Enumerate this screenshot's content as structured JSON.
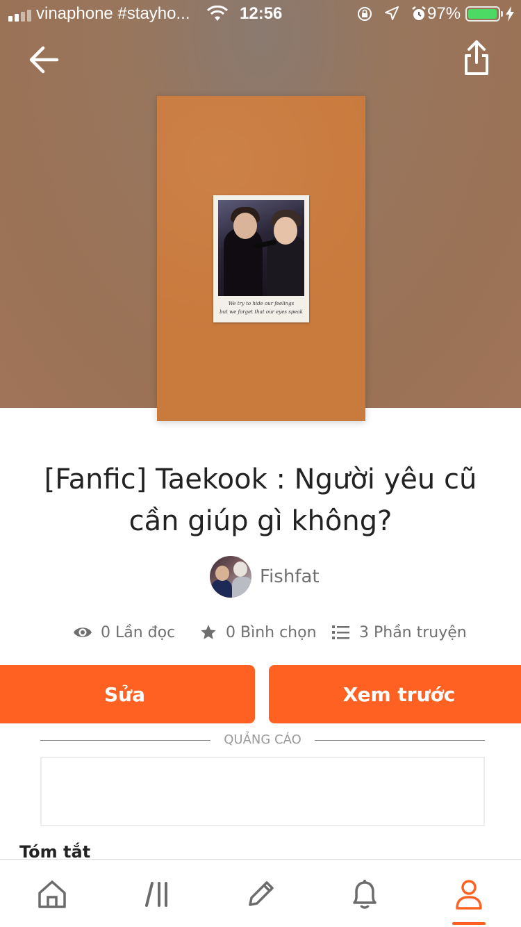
{
  "status_bar": {
    "carrier": "vinaphone #stayho...",
    "time": "12:56",
    "battery_percent": "97%",
    "battery_level": 0.97
  },
  "header": {
    "back_icon": "arrow-left-icon",
    "share_icon": "share-icon"
  },
  "cover": {
    "quote_line1": "We try to hide our feelings",
    "quote_line2": "but we forget that our eyes speak"
  },
  "story": {
    "title": "[Fanfic] Taekook : Người yêu cũ cần giúp gì không?",
    "author": "Fishfat",
    "stats": {
      "reads": "0 Lần đọc",
      "votes": "0 Bình chọn",
      "parts": "3 Phần truyện"
    }
  },
  "actions": {
    "edit_label": "Sửa",
    "preview_label": "Xem trước"
  },
  "ad": {
    "label": "QUẢNG CÁO"
  },
  "summary": {
    "heading": "Tóm tắt"
  },
  "tab_bar": {
    "tabs": [
      {
        "icon": "home-icon"
      },
      {
        "icon": "library-icon"
      },
      {
        "icon": "pencil-icon"
      },
      {
        "icon": "bell-icon"
      },
      {
        "icon": "profile-icon"
      }
    ],
    "active_index": 4
  },
  "colors": {
    "accent": "#ff6122",
    "cover": "#c97a3d",
    "hero_bg": "#9a7256"
  }
}
